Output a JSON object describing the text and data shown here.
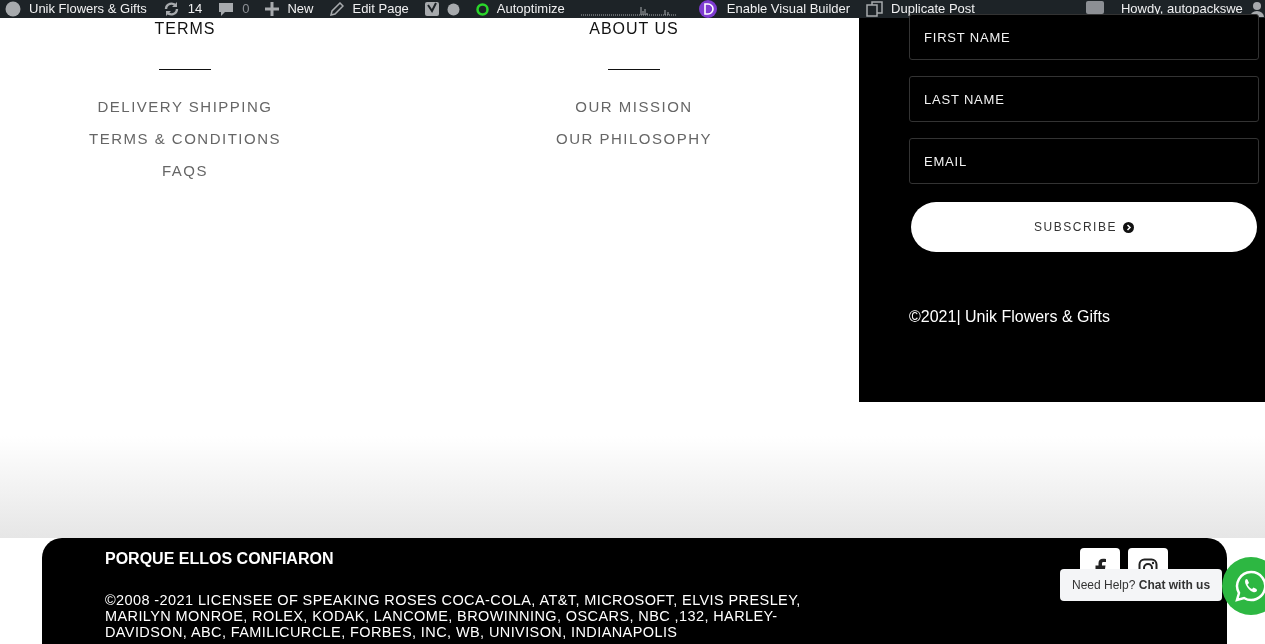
{
  "admin_bar": {
    "site_name": "Unik Flowers & Gifts",
    "updates_count": "14",
    "comments_count": "0",
    "new_label": "New",
    "edit_label": "Edit Page",
    "autoptimize_label": "Autoptimize",
    "visual_builder_label": "Enable Visual Builder",
    "duplicate_label": "Duplicate Post",
    "greeting": "Howdy, autopackswe"
  },
  "footer_columns": [
    {
      "heading": "TERMS",
      "links": [
        "DELIVERY SHIPPING",
        "TERMS & CONDITIONS",
        "FAQS"
      ]
    },
    {
      "heading": "ABOUT US",
      "links": [
        "OUR MISSION",
        "OUR PHILOSOPHY"
      ]
    }
  ],
  "newsletter": {
    "fields": [
      {
        "placeholder": "FIRST NAME"
      },
      {
        "placeholder": "LAST NAME"
      },
      {
        "placeholder": "EMAIL"
      }
    ],
    "button": "SUBSCRIBE",
    "copyright": "©2021| Unik Flowers & Gifts"
  },
  "bottom_footer": {
    "title": "PORQUE ELLOS CONFIARON",
    "text": "©2008 -2021 LICENSEE OF SPEAKING ROSES COCA-COLA, AT&T, MICROSOFT, ELVIS PRESLEY, MARILYN MONROE, ROLEX, KODAK, LANCOME, BROWINNING, OSCARS, NBC ,132, HARLEY-DAVIDSON, ABC, FAMILICURCLE, FORBES, INC, WB, UNIVISON, INDIANAPOLIS"
  },
  "chat": {
    "text": "Need Help? **Chat with us**"
  }
}
